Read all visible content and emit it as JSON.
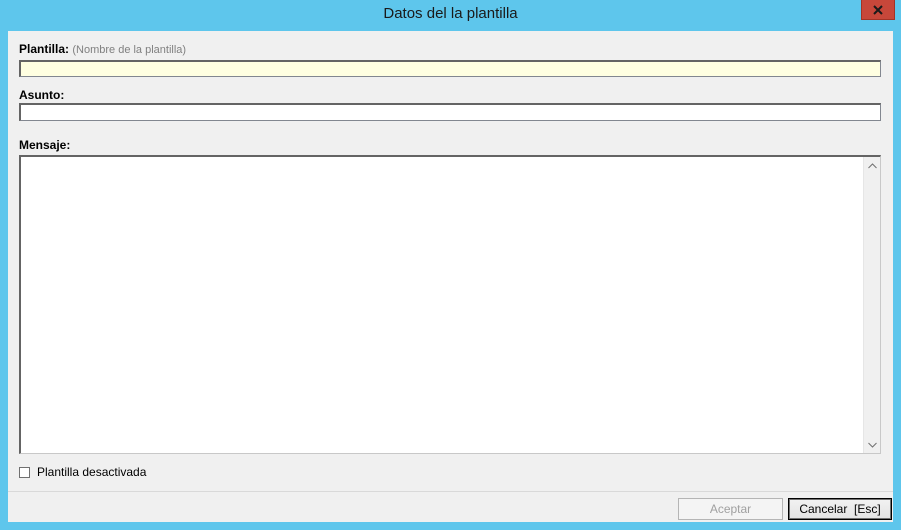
{
  "window": {
    "title": "Datos del la plantilla",
    "close_glyph": "✕"
  },
  "form": {
    "template_label": "Plantilla:",
    "template_hint": "(Nombre de la plantilla)",
    "template_value": "",
    "subject_label": "Asunto:",
    "subject_value": "",
    "message_label": "Mensaje:",
    "message_value": "",
    "disabled_checkbox_label": "Plantilla desactivada",
    "disabled_checked": false
  },
  "buttons": {
    "accept_label": "Aceptar",
    "cancel_label": "Cancelar  [Esc]"
  },
  "icons": {
    "close": "close-icon",
    "scroll_up": "chevron-up-icon",
    "scroll_down": "chevron-down-icon"
  },
  "colors": {
    "titlebar": "#5ec6ec",
    "close_button": "#c7473a",
    "active_field": "#ffffe1"
  }
}
